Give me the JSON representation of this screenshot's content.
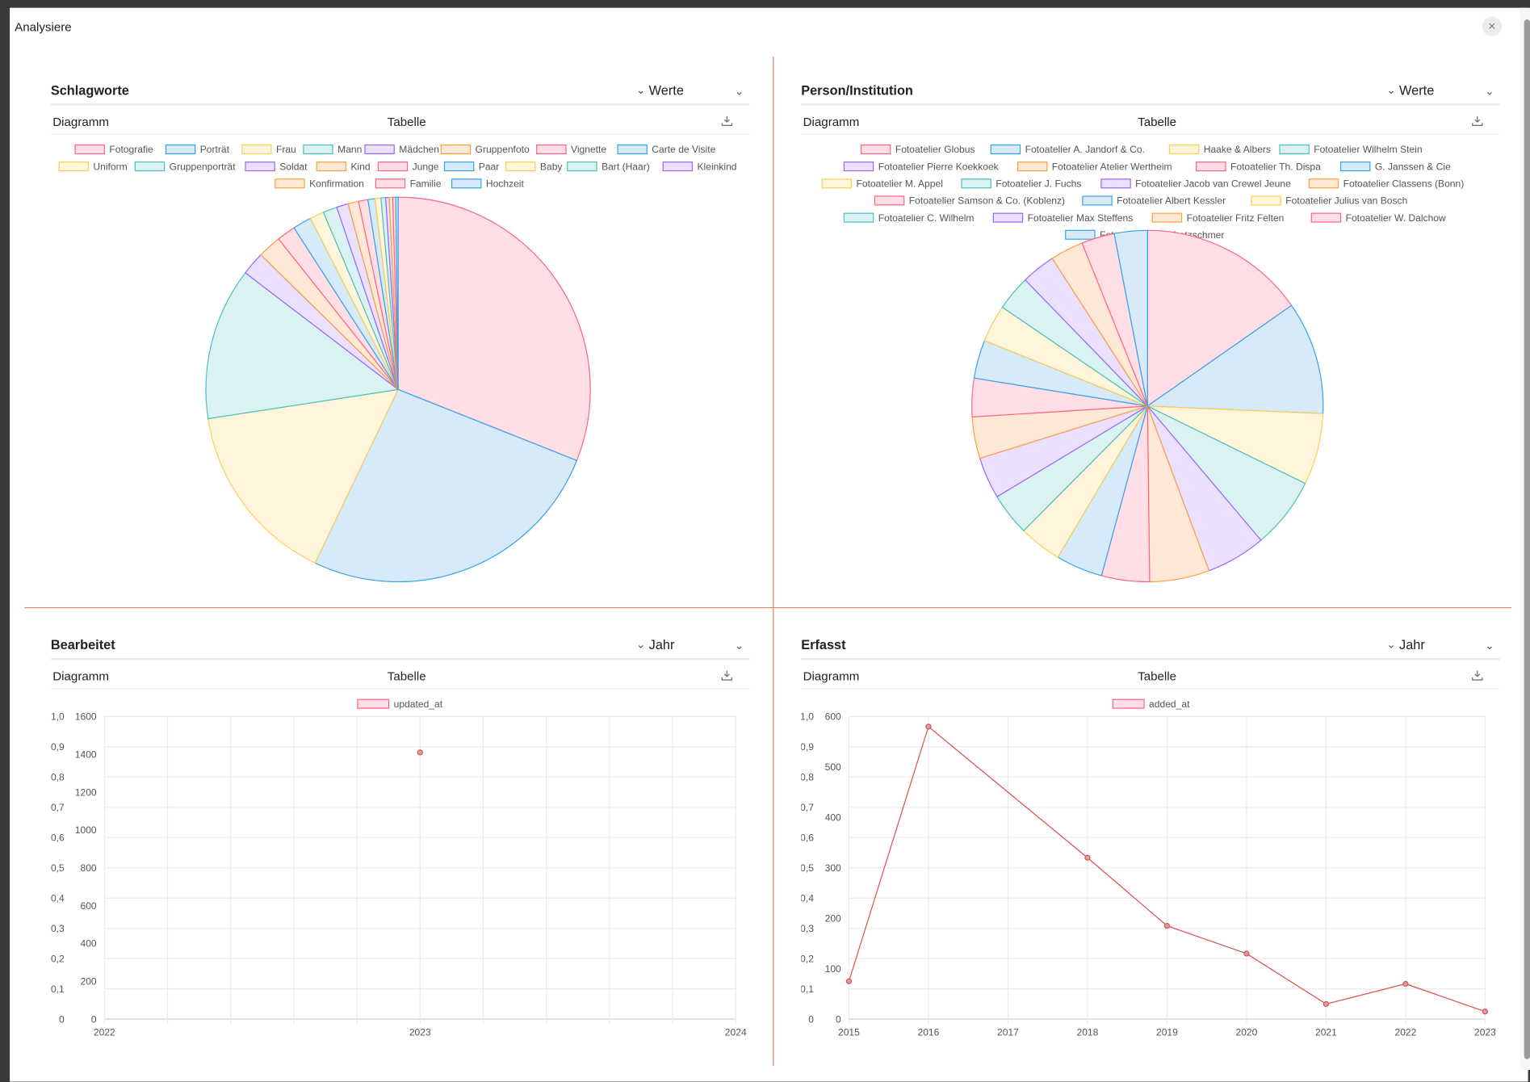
{
  "modal": {
    "title": "Analysiere",
    "close_label": "×"
  },
  "panels": [
    {
      "title": "Schlagworte",
      "selector_prefix": "⌄",
      "selector_value": "Werte",
      "selector_caret": "⌄",
      "tab_chart": "Diagramm",
      "tab_table": "Tabelle",
      "chart_data": {
        "type": "pie",
        "legend": [
          "Fotografie",
          "Porträt",
          "Frau",
          "Mann",
          "Mädchen",
          "Gruppenfoto",
          "Vignette",
          "Carte de Visite",
          "Uniform",
          "Gruppenporträt",
          "Soldat",
          "Kind",
          "Junge",
          "Paar",
          "Baby",
          "Bart (Haar)",
          "Kleinkind",
          "Konfirmation",
          "Familie",
          "Hochzeit"
        ],
        "values": [
          31.5,
          26.5,
          15.7,
          13.0,
          2.0,
          2.0,
          1.6,
          1.6,
          1.2,
          1.2,
          1.0,
          0.9,
          0.8,
          0.6,
          0.5,
          0.4,
          0.3,
          0.3,
          0.25,
          0.2
        ],
        "legend_position": "top"
      }
    },
    {
      "title": "Person/Institution",
      "selector_prefix": "⌄",
      "selector_value": "Werte",
      "selector_caret": "⌄",
      "tab_chart": "Diagramm",
      "tab_table": "Tabelle",
      "chart_data": {
        "type": "pie",
        "legend": [
          "Fotoatelier Globus",
          "Fotoatelier A. Jandorf & Co.",
          "Haake & Albers",
          "Fotoatelier Wilhelm Stein",
          "Fotoatelier Pierre Koekkoek",
          "Fotoatelier Atelier Wertheim",
          "Fotoatelier Th. Dispa",
          "G. Janssen & Cie",
          "Fotoatelier M. Appel",
          "Fotoatelier J. Fuchs",
          "Fotoatelier Jacob van Crewel Jeune",
          "Fotoatelier Classens (Bonn)",
          "Fotoatelier Samson & Co. (Koblenz)",
          "Fotoatelier Albert Kessler",
          "Fotoatelier Julius van Bosch",
          "Fotoatelier C. Wilhelm",
          "Fotoatelier Max Steffens",
          "Fotoatelier Fritz Felten",
          "Fotoatelier W. Dalchow",
          "Fotoatelier Max Kretzschmer"
        ],
        "values": [
          15.6,
          10.6,
          6.7,
          6.7,
          5.6,
          5.6,
          4.5,
          4.4,
          4.0,
          4.0,
          3.9,
          3.9,
          3.6,
          3.6,
          3.5,
          3.3,
          3.2,
          3.1,
          3.1,
          3.1
        ],
        "legend_position": "top"
      }
    },
    {
      "title": "Bearbeitet",
      "selector_prefix": "⌄",
      "selector_value": "Jahr",
      "selector_caret": "⌄",
      "tab_chart": "Diagramm",
      "tab_table": "Tabelle",
      "chart_data": {
        "type": "line",
        "series": [
          {
            "name": "updated_at",
            "x": [
              "2023"
            ],
            "values": [
              1410
            ]
          }
        ],
        "x_ticks": [
          "2022",
          "2023",
          "2024"
        ],
        "y_ticks": [
          "0",
          "200",
          "400",
          "600",
          "800",
          "1000",
          "1200",
          "1400",
          "1600"
        ],
        "y_secondary_ticks": [
          "0",
          "0,1",
          "0,2",
          "0,3",
          "0,4",
          "0,5",
          "0,6",
          "0,7",
          "0,8",
          "0,9",
          "1,0"
        ],
        "ylim": [
          0,
          1600
        ],
        "grid": true,
        "legend_position": "top"
      }
    },
    {
      "title": "Erfasst",
      "selector_prefix": "⌄",
      "selector_value": "Jahr",
      "selector_caret": "⌄",
      "tab_chart": "Diagramm",
      "tab_table": "Tabelle",
      "chart_data": {
        "type": "line",
        "series": [
          {
            "name": "added_at",
            "x": [
              "2015",
              "2016",
              "2018",
              "2019",
              "2020",
              "2021",
              "2022",
              "2023"
            ],
            "values": [
              75,
              580,
              320,
              185,
              130,
              30,
              70,
              15
            ]
          }
        ],
        "x_ticks": [
          "2015",
          "2016",
          "2017",
          "2018",
          "2019",
          "2020",
          "2021",
          "2022",
          "2023"
        ],
        "y_ticks": [
          "0",
          "100",
          "200",
          "300",
          "400",
          "500",
          "600"
        ],
        "y_secondary_ticks": [
          "0",
          "0,1",
          "0,2",
          "0,3",
          "0,4",
          "0,5",
          "0,6",
          "0,7",
          "0,8",
          "0,9",
          "1,0"
        ],
        "ylim": [
          0,
          600
        ],
        "grid": true,
        "legend_position": "top"
      }
    }
  ],
  "colors": {
    "palette_fill": [
      "#ffdfe5",
      "#d6eafa",
      "#fff5db",
      "#dbf2f2",
      "#ebe0ff",
      "#ffe9d6"
    ],
    "palette_stroke": [
      "#ff6384",
      "#36a2eb",
      "#ffcd56",
      "#4bc0c0",
      "#9966ff",
      "#ff9f40"
    ],
    "line": "#d94f4f",
    "line_fill": "#d9a0a0",
    "divider": "#e0896f"
  }
}
